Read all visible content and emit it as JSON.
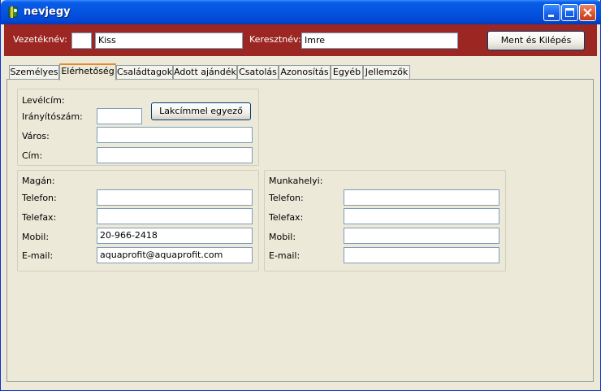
{
  "window": {
    "title": "nevjegy"
  },
  "header": {
    "last_name_label": "Vezetéknév:",
    "prefix_value": "",
    "last_name_value": "Kiss",
    "first_name_label": "Keresztnév:",
    "first_name_value": "Imre",
    "save_exit_label": "Ment és Kilépés"
  },
  "tabs": [
    {
      "label": "Személyes"
    },
    {
      "label": "Elérhetőség"
    },
    {
      "label": "Családtagok"
    },
    {
      "label": "Adott ajándék"
    },
    {
      "label": "Csatolás"
    },
    {
      "label": "Azonosítás"
    },
    {
      "label": "Egyéb"
    },
    {
      "label": "Jellemzők"
    }
  ],
  "mailing": {
    "title": "Levélcím:",
    "zip_label": "Irányítószám:",
    "zip_value": "",
    "same_as_home_label": "Lakcímmel egyező",
    "city_label": "Város:",
    "city_value": "",
    "address_label": "Cím:",
    "address_value": ""
  },
  "private": {
    "title": "Magán:",
    "phone_label": "Telefon:",
    "phone_value": "",
    "fax_label": "Telefax:",
    "fax_value": "",
    "mobile_label": "Mobil:",
    "mobile_value": "20-966-2418",
    "email_label": "E-mail:",
    "email_value": "aquaprofit@aquaprofit.com"
  },
  "work": {
    "title": "Munkahelyi:",
    "phone_label": "Telefon:",
    "phone_value": "",
    "fax_label": "Telefax:",
    "fax_value": "",
    "mobile_label": "Mobil:",
    "mobile_value": "",
    "email_label": "E-mail:",
    "email_value": ""
  },
  "colors": {
    "header_bg": "#9B2622",
    "titlebar": "#0054E3",
    "panel_bg": "#ECE9D8",
    "active_tab_accent": "#E68B2C"
  }
}
